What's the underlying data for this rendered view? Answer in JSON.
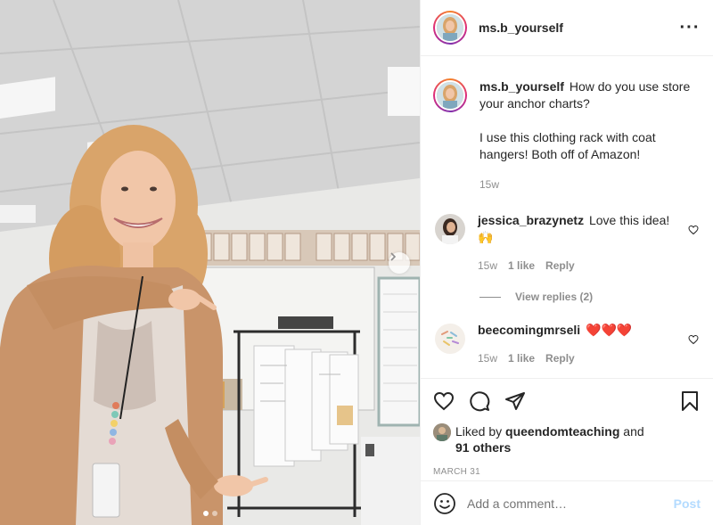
{
  "post": {
    "author": "ms.b_yourself",
    "more_icon": "more-options-icon",
    "carousel": {
      "slides": 2,
      "active_slide": 1
    }
  },
  "comments": [
    {
      "username": "ms.b_yourself",
      "lines": [
        "How do you use store your anchor charts?",
        "",
        "I use this clothing rack with coat hangers! Both off of Amazon!"
      ],
      "time": "15w"
    },
    {
      "username": "jessica_brazynetz",
      "text": "Love this idea! 🙌",
      "time": "15w",
      "likes": "1 like",
      "reply": "Reply",
      "view_replies": "View replies (2)"
    },
    {
      "username": "beecomingmrseli",
      "text": "❤️❤️❤️",
      "time": "15w",
      "likes": "1 like",
      "reply": "Reply"
    }
  ],
  "actions": {
    "liked_by_prefix": "Liked by",
    "liked_by_user": "queendomteaching",
    "liked_by_and": "and",
    "others": "91 others",
    "date": "MARCH 31"
  },
  "add_comment": {
    "placeholder": "Add a comment…",
    "post_label": "Post"
  },
  "colors": {
    "post_button": "#b3dbff",
    "secondary_text": "#8e8e8e",
    "heart_red": "#ed4956"
  }
}
